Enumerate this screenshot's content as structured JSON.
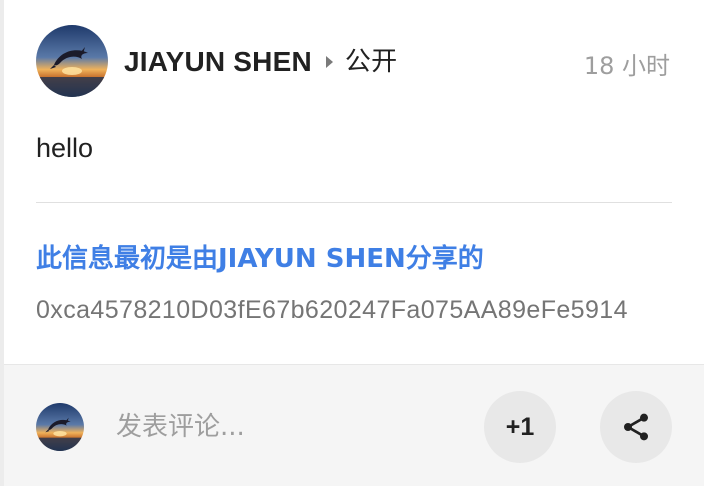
{
  "post": {
    "author": "JIAYUN SHEN",
    "visibility": "公开",
    "timestamp": "18 小时",
    "text": "hello",
    "shared_by": "此信息最初是由JIAYUN SHEN分享的",
    "hash": "0xca4578210D03fE67b620247Fa075AA89eFe5914"
  },
  "footer": {
    "comment_placeholder": "发表评论...",
    "plus_one_label": "+1",
    "share_icon": "share-icon"
  },
  "colors": {
    "link": "#3f7fe5",
    "muted": "#9e9e9e",
    "text": "#212121",
    "footer_bg": "#f5f5f5",
    "button_bg": "#e8e8e8"
  }
}
